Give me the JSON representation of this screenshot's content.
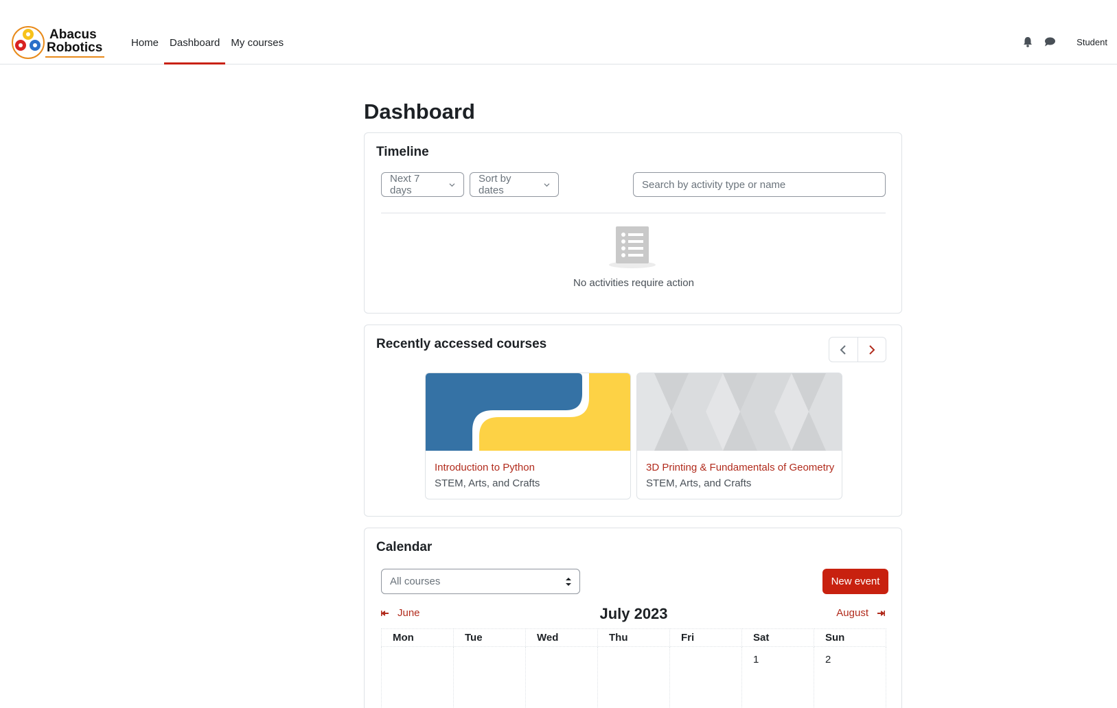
{
  "brand": {
    "line1": "Abacus",
    "line2": "Robotics"
  },
  "nav": {
    "links": [
      {
        "label": "Home"
      },
      {
        "label": "Dashboard"
      },
      {
        "label": "My courses"
      }
    ],
    "active_index": 1,
    "user": "Student"
  },
  "page": {
    "title": "Dashboard"
  },
  "timeline": {
    "title": "Timeline",
    "filter": "Next 7 days",
    "sort": "Sort by dates",
    "search_placeholder": "Search by activity type or name",
    "empty_message": "No activities require action"
  },
  "recent": {
    "title": "Recently accessed courses",
    "courses": [
      {
        "name": "Introduction to Python",
        "category": "STEM, Arts, and Crafts"
      },
      {
        "name": "3D Printing & Fundamentals of Geometry",
        "category": "STEM, Arts, and Crafts"
      }
    ]
  },
  "calendar": {
    "title": "Calendar",
    "course_filter": "All courses",
    "new_event": "New event",
    "prev_month": "June",
    "next_month": "August",
    "month_title": "July 2023",
    "weekdays": [
      "Mon",
      "Tue",
      "Wed",
      "Thu",
      "Fri",
      "Sat",
      "Sun"
    ],
    "first_row": [
      "",
      "",
      "",
      "",
      "",
      "1",
      "2"
    ]
  },
  "colors": {
    "accent": "#c8210f",
    "link": "#b12b1c",
    "python_blue": "#3572a5",
    "python_yellow": "#fdd245"
  }
}
